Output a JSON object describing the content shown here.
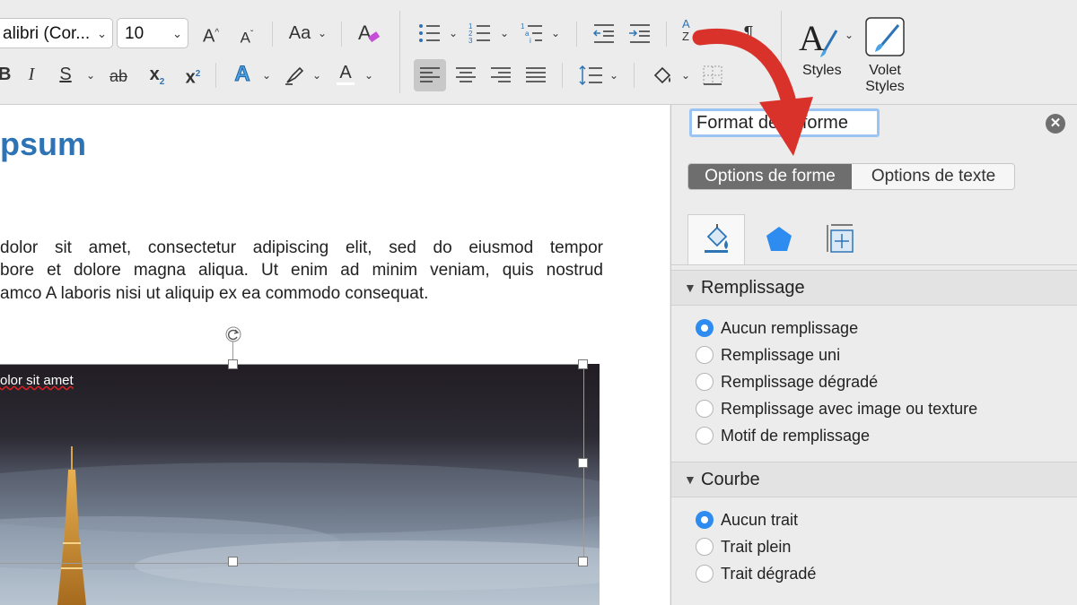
{
  "ribbon": {
    "font_name": "alibri (Cor...",
    "font_size": "10",
    "grow_font": "A",
    "shrink_font": "A",
    "change_case": "Aa",
    "italic": "I",
    "underline": "S",
    "strikethrough": "ab",
    "subscript": "x",
    "subscript_mark": "2",
    "superscript": "x",
    "superscript_mark": "2",
    "text_effects": "A",
    "font_color": "A",
    "pilcrow": "¶",
    "styles_label": "Styles",
    "styles_pane_label_1": "Volet",
    "styles_pane_label_2": "Styles",
    "sort_a": "A",
    "sort_z": "Z"
  },
  "document": {
    "title": "psum",
    "lines": [
      "dolor sit amet, consectetur adipiscing elit, sed do eiusmod tempor",
      "bore et dolore magna aliqua. Ut enim ad minim veniam, quis nostrud",
      "amco A laboris nisi ut aliquip ex ea commodo consequat."
    ],
    "textbox_text": "olor sit amet"
  },
  "panel": {
    "title": "Format de la forme",
    "tabs": [
      {
        "label": "Options de forme",
        "active": true
      },
      {
        "label": "Options de texte",
        "active": false
      }
    ],
    "icons": [
      "fill-line-icon",
      "effects-pentagon-icon",
      "size-layout-icon"
    ],
    "fill_section": {
      "title": "Remplissage",
      "options": [
        {
          "label": "Aucun remplissage",
          "selected": true
        },
        {
          "label": "Remplissage uni",
          "selected": false
        },
        {
          "label": "Remplissage dégradé",
          "selected": false
        },
        {
          "label": "Remplissage avec image ou texture",
          "selected": false
        },
        {
          "label": "Motif de remplissage",
          "selected": false
        }
      ]
    },
    "line_section": {
      "title": "Courbe",
      "options": [
        {
          "label": "Aucun trait",
          "selected": true
        },
        {
          "label": "Trait plein",
          "selected": false
        },
        {
          "label": "Trait dégradé",
          "selected": false
        }
      ]
    }
  },
  "colors": {
    "accent": "#2e8bf0",
    "title_blue": "#2e74b5",
    "arrow_red": "#d9322b",
    "active_tab": "#6e6e6e"
  }
}
